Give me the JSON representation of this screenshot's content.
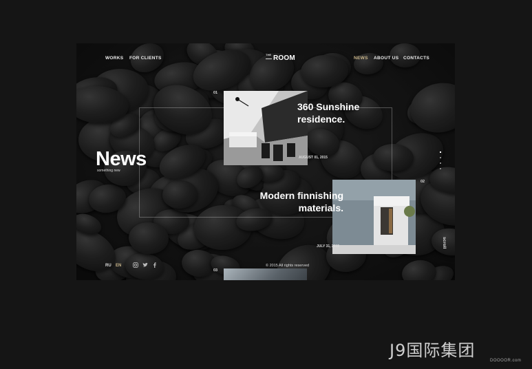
{
  "nav": {
    "left": [
      {
        "label": "WORKS"
      },
      {
        "label": "FOR CLIENTS"
      }
    ],
    "right": [
      {
        "label": "NEWS",
        "active": true
      },
      {
        "label": "ABOUT US"
      },
      {
        "label": "CONTACTS"
      }
    ]
  },
  "logo": {
    "the": "THE",
    "room": "ROOM"
  },
  "page": {
    "title": "News",
    "subtitle": "something new"
  },
  "posts": [
    {
      "number": "01",
      "title_line1": "360 Sunshine",
      "title_line2": "residence.",
      "date": "AUGUST 01, 2015"
    },
    {
      "number": "02",
      "title_line1": "Modern finnishing",
      "title_line2": "materials.",
      "date": "JULY 31, 2015"
    },
    {
      "number": "03"
    }
  ],
  "scroll": {
    "label": "scroll",
    "dots": 4,
    "active_index": 0
  },
  "footer": {
    "languages": [
      {
        "label": "RU"
      },
      {
        "label": "EN",
        "active": true
      }
    ],
    "social_icons": [
      "instagram-icon",
      "twitter-icon",
      "facebook-icon"
    ],
    "copyright": "© 2015  All rights reserved"
  },
  "watermark": {
    "text": "J9国际集团",
    "sub": "DOOOOR.com"
  },
  "colors": {
    "accent": "#c9b58a",
    "background": "#151515"
  }
}
